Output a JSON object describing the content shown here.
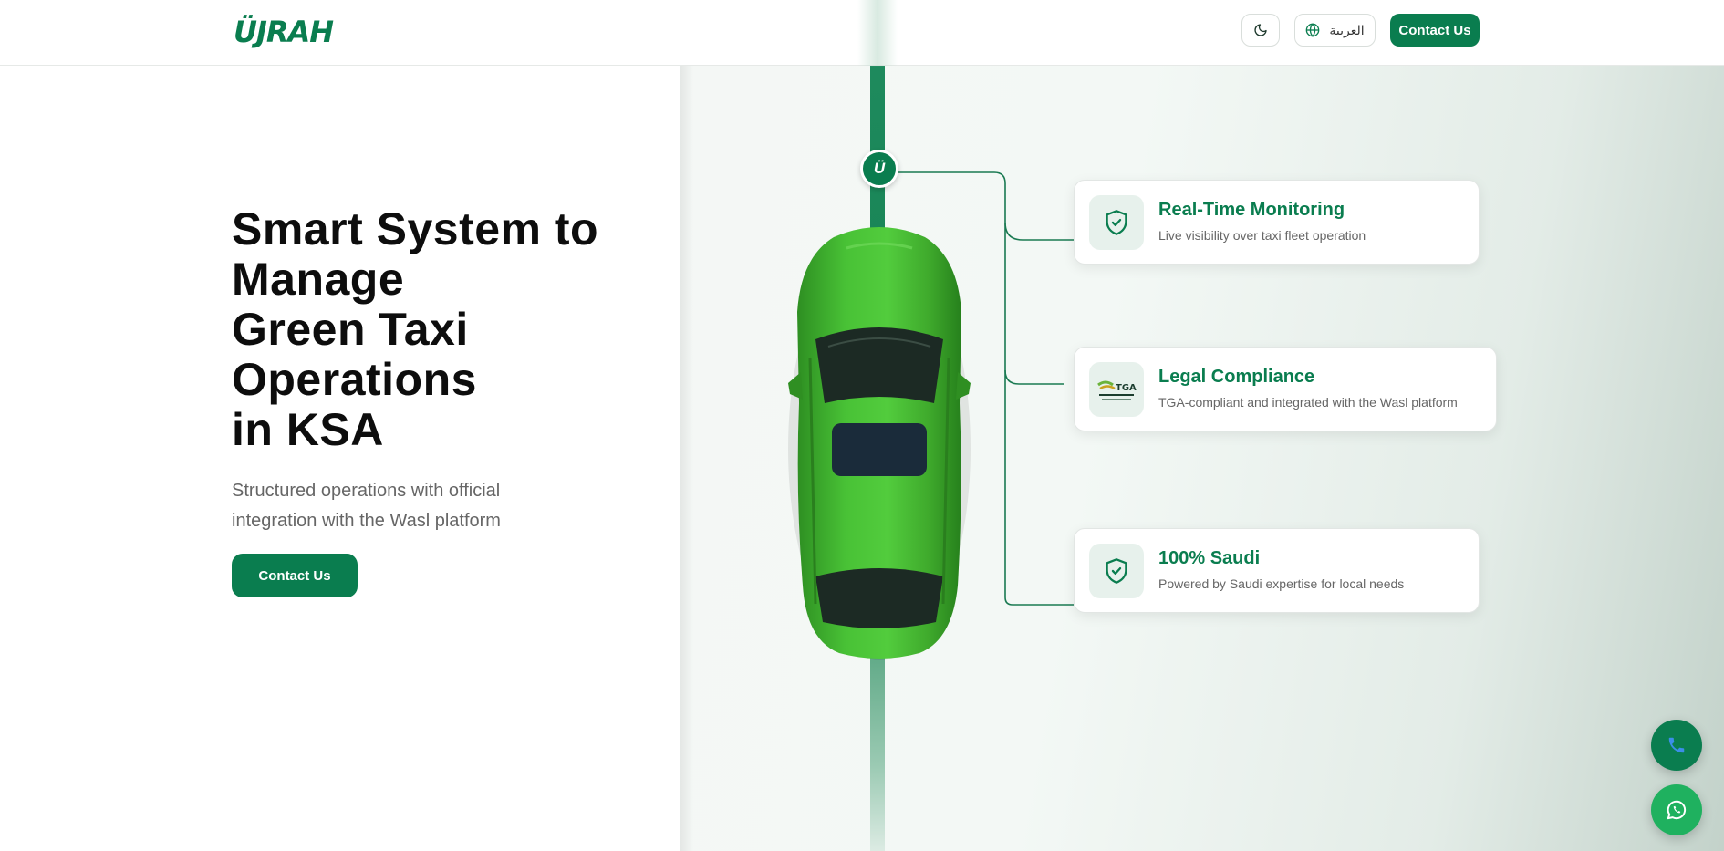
{
  "brand": {
    "logo_text": "ÜJRAH",
    "primary_color": "#0a7d4f"
  },
  "header": {
    "theme_toggle_icon": "moon-icon",
    "language_icon": "globe-icon",
    "language_label": "العربية",
    "contact_label": "Contact Us"
  },
  "hero": {
    "title_lines": [
      "Smart System to",
      "Manage",
      "Green Taxi",
      "Operations",
      "in KSA"
    ],
    "subtitle_lines": [
      "Structured operations with official",
      "integration with the Wasl platform"
    ],
    "cta_label": "Contact Us"
  },
  "diagram": {
    "node_label": "Ü",
    "features": [
      {
        "icon": "shield-check-icon",
        "title": "Real-Time Monitoring",
        "description": "Live visibility over taxi fleet operation"
      },
      {
        "icon": "tga-logo",
        "logo_text": "TGA",
        "title": "Legal Compliance",
        "description": "TGA-compliant and integrated with the Wasl platform"
      },
      {
        "icon": "shield-check-icon",
        "title": "100% Saudi",
        "description": "Powered by Saudi expertise for local needs"
      }
    ]
  },
  "floating_actions": [
    {
      "icon": "phone-icon",
      "color": "#0a7d4f"
    },
    {
      "icon": "whatsapp-icon",
      "color": "#1fb15f"
    }
  ]
}
